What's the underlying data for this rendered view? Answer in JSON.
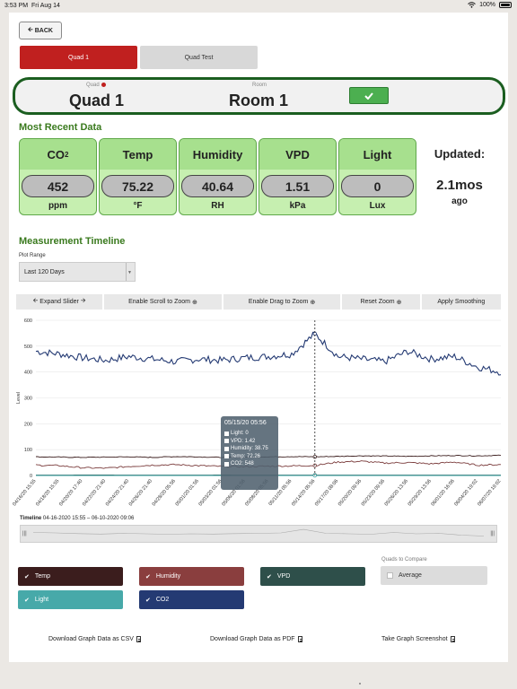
{
  "status_bar": {
    "time": "3:53 PM",
    "date": "Fri Aug 14",
    "battery": "100%"
  },
  "back_button": {
    "label": "BACK",
    "icon": "arrow-left-icon"
  },
  "tabs": [
    {
      "label": "Quad 1",
      "active": true
    },
    {
      "label": "Quad Test",
      "active": false
    }
  ],
  "quad_selector": {
    "quad_label": "Quad",
    "quad_name": "Quad 1",
    "room_label": "Room",
    "room_name": "Room 1"
  },
  "most_recent": {
    "title": "Most Recent Data",
    "metrics": [
      {
        "label": "CO",
        "sub": "2",
        "value": "452",
        "unit": "ppm"
      },
      {
        "label": "Temp",
        "value": "75.22",
        "unit": "°F"
      },
      {
        "label": "Humidity",
        "value": "40.64",
        "unit": "RH"
      },
      {
        "label": "VPD",
        "value": "1.51",
        "unit": "kPa"
      },
      {
        "label": "Light",
        "value": "0",
        "unit": "Lux"
      }
    ],
    "updated_label": "Updated:",
    "updated_value": "2.1mos",
    "updated_suffix": "ago"
  },
  "timeline": {
    "title": "Measurement Timeline",
    "plot_range_label": "Plot Range",
    "plot_range_value": "Last 120 Days",
    "toolbar": {
      "expand": "Expand Slider",
      "scroll_zoom": "Enable Scroll to Zoom",
      "drag_zoom": "Enable Drag to Zoom",
      "reset_zoom": "Reset Zoom",
      "smoothing": "Apply Smoothing"
    },
    "range_label": "Timeline",
    "range_value": "04-16-2020 15:55 – 06-10-2020 09:06"
  },
  "tooltip": {
    "title": "05/15/20 05:56",
    "rows": [
      "Light: 0",
      "VPD: 1.42",
      "Humidity: 38.75",
      "Temp: 72.26",
      "CO2: 548"
    ]
  },
  "chart_data": {
    "type": "line",
    "ylabel": "Level",
    "ylim": [
      0,
      600
    ],
    "yticks": [
      "0",
      "100",
      "200",
      "300",
      "400",
      "500",
      "600"
    ],
    "grid": true,
    "categories": [
      "04/16/20 15:55",
      "04/18/20 15:55",
      "04/20/20 17:40",
      "04/22/20 21:40",
      "04/24/20 21:40",
      "04/26/20 21:40",
      "04/28/20 05:56",
      "05/01/20 01:56",
      "05/03/20 01:56",
      "05/06/20 01:56",
      "05/08/20 05:56",
      "05/11/20 05:56",
      "05/14/20 05:56",
      "05/17/20 08:06",
      "05/20/20 09:56",
      "05/23/20 09:56",
      "05/26/20 13:56",
      "05/29/20 13:56",
      "06/01/20 16:06",
      "06/04/20 19:02",
      "06/07/20 19:02"
    ],
    "series": [
      {
        "name": "CO2",
        "color": "#243a73",
        "values": [
          480,
          470,
          455,
          445,
          460,
          450,
          440,
          450,
          445,
          455,
          460,
          470,
          548,
          460,
          450,
          440,
          480,
          450,
          460,
          420,
          400
        ]
      },
      {
        "name": "Temp",
        "color": "#3b1d1d",
        "values": [
          72,
          71,
          70,
          71,
          72,
          70,
          73,
          72,
          70,
          71,
          72,
          73,
          72.26,
          74,
          76,
          75,
          74,
          76,
          77,
          76,
          78
        ]
      },
      {
        "name": "Humidity",
        "color": "#7a3b3b",
        "values": [
          40,
          38,
          30,
          28,
          35,
          40,
          42,
          38,
          35,
          34,
          36,
          37,
          38.75,
          52,
          55,
          48,
          50,
          45,
          52,
          40,
          42
        ]
      },
      {
        "name": "VPD",
        "color": "#2e4f4a",
        "values": [
          1.4,
          1.5,
          1.6,
          1.6,
          1.5,
          1.4,
          1.4,
          1.5,
          1.6,
          1.5,
          1.5,
          1.4,
          1.42,
          1.5,
          1.4,
          1.5,
          1.5,
          1.5,
          1.4,
          1.5,
          1.5
        ]
      },
      {
        "name": "Light",
        "color": "#3aa6a6",
        "values": [
          0,
          0,
          0,
          0,
          0,
          0,
          0,
          0,
          0,
          0,
          0,
          0,
          0,
          0,
          0,
          0,
          0,
          0,
          0,
          0,
          0
        ]
      }
    ]
  },
  "legend": {
    "items": [
      {
        "label": "Temp",
        "color": "#3b1d1d"
      },
      {
        "label": "Humidity",
        "color": "#8a3e3e"
      },
      {
        "label": "VPD",
        "color": "#2e4f4a"
      },
      {
        "label": "Light",
        "color": "#47a9a9"
      },
      {
        "label": "CO2",
        "color": "#243a73"
      }
    ],
    "compare_label": "Quads to Compare",
    "average_label": "Average"
  },
  "downloads": {
    "csv": "Download Graph Data as CSV",
    "pdf": "Download Graph Data as PDF",
    "screenshot": "Take Graph Screenshot"
  }
}
